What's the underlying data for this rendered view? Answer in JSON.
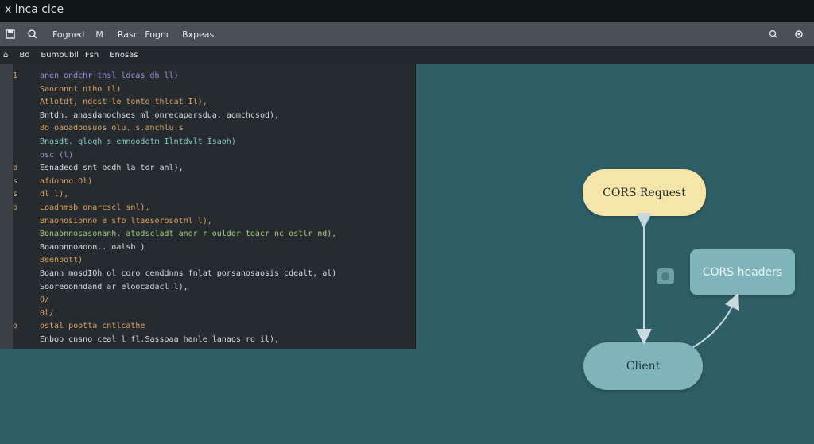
{
  "window": {
    "title": "x lnca cice"
  },
  "toolbar": {
    "items": [
      "Fogned",
      "M",
      "Rasr",
      "Fognc",
      "Bxpeas"
    ],
    "right_icons": [
      "search-icon",
      "gear-icon"
    ]
  },
  "subbar": {
    "tabs": [
      "Bo",
      "Bumbubil",
      "Fsn",
      "Enosas"
    ]
  },
  "editor": {
    "lines": [
      {
        "n": "1",
        "text": "anen ondchr tnsl ldcas dh ll)",
        "cls": "c-purple"
      },
      {
        "n": "",
        "text": "Saoconnt ntho tl)",
        "cls": "c-orange"
      },
      {
        "n": "",
        "text": "Atlotdt, ndcst le tonto thlcat Il),",
        "cls": "c-orange"
      },
      {
        "n": "",
        "text": "Bntdn. anasdanochses ml onrecaparsdua. aomchcsod),",
        "cls": "c-white"
      },
      {
        "n": "",
        "text": "Bo oaoadoosuos olu. s.anchlu s",
        "cls": "c-orange"
      },
      {
        "n": "",
        "text": "Bnasdt. gloqh s emnoodotm Ilntdvlt Isaoh)",
        "cls": "c-teal"
      },
      {
        "n": "",
        "text": "osc (l)",
        "cls": "c-purple"
      },
      {
        "n": "b",
        "text": "Esnadeod snt bcdh la tor anl),",
        "cls": "c-white"
      },
      {
        "n": "s",
        "text": "afdonno Ol)",
        "cls": "c-orange"
      },
      {
        "n": "s",
        "text": "dl l),",
        "cls": "c-orange"
      },
      {
        "n": "b",
        "text": "Loadnmsb onarcscl snl),",
        "cls": "c-orange"
      },
      {
        "n": "",
        "text": "Bnaonosionno e sfb ltaesorosotnl l),",
        "cls": "c-orange"
      },
      {
        "n": "",
        "text": "Bonaonnosasonanh. atodscladt anor r ouldor toacr nc ostlr nd),",
        "cls": "c-green"
      },
      {
        "n": "",
        "text": "Boaoonnoaoon.. oalsb )",
        "cls": "c-white"
      },
      {
        "n": "",
        "text": "Beenbott)",
        "cls": "c-orange"
      },
      {
        "n": "",
        "text": "Boann mosdIOh ol coro cenddnns fnlat porsanosaosis cdealt, al)",
        "cls": "c-white"
      },
      {
        "n": "",
        "text": "Sooreoonndand ar eloocadacl l),",
        "cls": "c-white"
      },
      {
        "n": "",
        "text": "0/",
        "cls": "c-orange"
      },
      {
        "n": "",
        "text": "   0l/",
        "cls": "c-orange"
      },
      {
        "n": "oo",
        "text": "ostal pootta cntlcathe",
        "cls": "c-orange"
      },
      {
        "n": "",
        "text": "Enboo cnsno ceal l fl.Sassoaa hanle lanaos ro il),",
        "cls": "c-white"
      }
    ]
  },
  "diagram": {
    "request_label": "CORS Request",
    "response_label": "CORS headers",
    "client_label": "Client"
  },
  "colors": {
    "background": "#2f5f66",
    "request_node": "#f6e4a8",
    "response_node": "#7fb4bd",
    "client_node": "#7fb4bd",
    "editor_bg": "#262b2f"
  }
}
